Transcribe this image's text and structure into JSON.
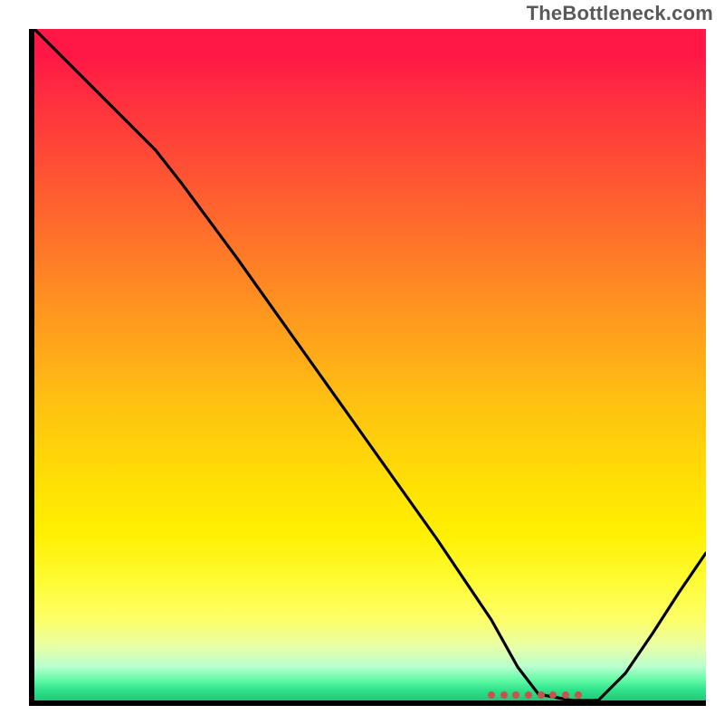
{
  "watermark": "TheBottleneck.com",
  "chart_data": {
    "type": "line",
    "title": "",
    "xlabel": "",
    "ylabel": "",
    "xlim": [
      0,
      1
    ],
    "ylim": [
      0,
      1
    ],
    "series": [
      {
        "name": "bottleneck-curve",
        "x": [
          0.0,
          0.05,
          0.1,
          0.18,
          0.22,
          0.3,
          0.4,
          0.5,
          0.6,
          0.68,
          0.72,
          0.75,
          0.8,
          0.84,
          0.88,
          0.92,
          0.96,
          1.0
        ],
        "y": [
          1.0,
          0.95,
          0.9,
          0.82,
          0.77,
          0.66,
          0.52,
          0.38,
          0.24,
          0.12,
          0.05,
          0.01,
          0.0,
          0.0,
          0.04,
          0.1,
          0.16,
          0.22
        ]
      }
    ],
    "markers": {
      "name": "optimal-range",
      "x": [
        0.7,
        0.72,
        0.74,
        0.76,
        0.78,
        0.8,
        0.82,
        0.84
      ],
      "y": [
        0.0,
        0.0,
        0.0,
        0.0,
        0.0,
        0.0,
        0.0,
        0.0
      ],
      "color": "#c9524b"
    },
    "gradient_colors": {
      "top": "#ff1846",
      "mid": "#ffe104",
      "bottom": "#1fc975"
    }
  }
}
